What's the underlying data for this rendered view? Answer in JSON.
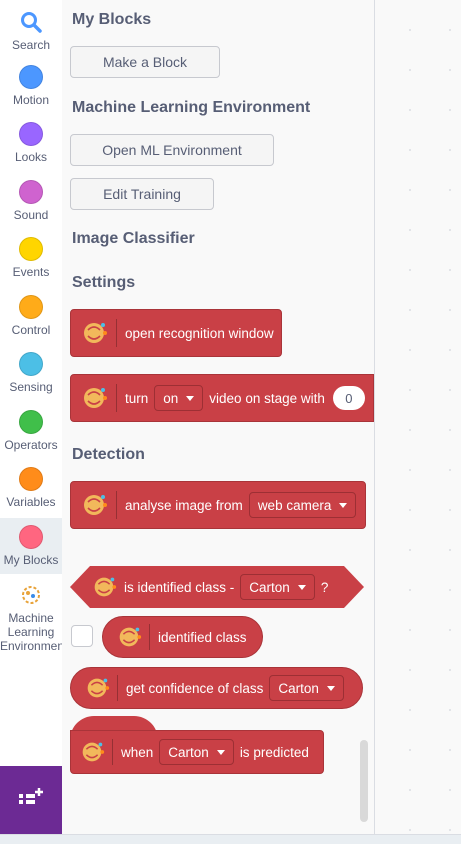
{
  "categories": [
    {
      "id": "search",
      "label": "Search",
      "icon": "search-icon",
      "color": "#4c97ff"
    },
    {
      "id": "motion",
      "label": "Motion",
      "icon": "circle",
      "color": "#4c97ff"
    },
    {
      "id": "looks",
      "label": "Looks",
      "icon": "circle",
      "color": "#9966ff"
    },
    {
      "id": "sound",
      "label": "Sound",
      "icon": "circle",
      "color": "#cf63cf"
    },
    {
      "id": "events",
      "label": "Events",
      "icon": "circle",
      "color": "#ffd500"
    },
    {
      "id": "control",
      "label": "Control",
      "icon": "circle",
      "color": "#ffab19"
    },
    {
      "id": "sensing",
      "label": "Sensing",
      "icon": "circle",
      "color": "#4cbfe6"
    },
    {
      "id": "operators",
      "label": "Operators",
      "icon": "circle",
      "color": "#40bf4a"
    },
    {
      "id": "variables",
      "label": "Variables",
      "icon": "circle",
      "color": "#ff8c1a"
    },
    {
      "id": "my_blocks",
      "label": "My Blocks",
      "icon": "circle",
      "color": "#ff6680"
    },
    {
      "id": "ml",
      "label_lines": [
        "Machine",
        "Learning",
        "Environment"
      ],
      "icon": "brain-icon",
      "color": "#e8a33a"
    }
  ],
  "extension_button": {
    "icon": "add-extension-icon",
    "color": "#6c2a94"
  },
  "palette": {
    "my_blocks_header": "My Blocks",
    "make_block_button": "Make a Block",
    "ml_env_header": "Machine Learning Environment",
    "open_ml_button": "Open ML Environment",
    "edit_training_button": "Edit Training",
    "image_classifier_header": "Image Classifier",
    "settings_header": "Settings",
    "detection_header": "Detection",
    "blocks": {
      "open_recognition": "open recognition window",
      "turn_prefix": "turn",
      "turn_dropdown": "on",
      "turn_middle": "video on stage with",
      "turn_number": "0",
      "analyse_prefix": "analyse image from",
      "analyse_dropdown": "web camera",
      "is_identified_prefix": "is identified class -",
      "is_identified_dropdown": "Carton",
      "is_identified_suffix": "?",
      "identified_class": "identified class",
      "confidence_prefix": "get confidence of class",
      "confidence_dropdown": "Carton",
      "when_prefix": "when",
      "when_dropdown": "Carton",
      "when_suffix": "is predicted"
    },
    "block_color": "#c94046"
  }
}
